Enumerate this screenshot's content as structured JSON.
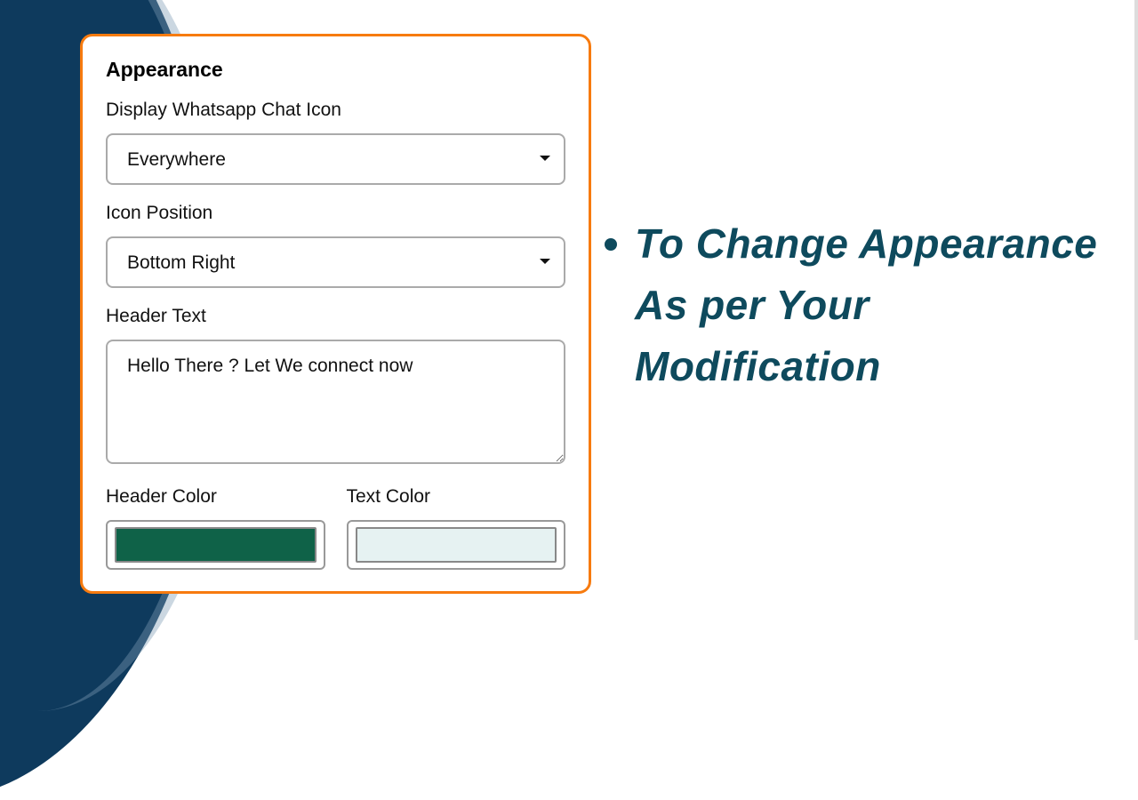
{
  "panel": {
    "title": "Appearance",
    "display_icon": {
      "label": "Display Whatsapp Chat Icon",
      "value": "Everywhere"
    },
    "icon_position": {
      "label": "Icon Position",
      "value": "Bottom Right"
    },
    "header_text": {
      "label": "Header Text",
      "value": "Hello There ? Let We connect now"
    },
    "header_color": {
      "label": "Header Color",
      "value": "#0f6248"
    },
    "text_color": {
      "label": "Text Color",
      "value": "#e6f2f2"
    }
  },
  "info": {
    "bullet_text": "To Change Appearance As per Your Modification"
  },
  "colors": {
    "accent": "#f77b0f",
    "brand_dark": "#0e4a5d"
  }
}
